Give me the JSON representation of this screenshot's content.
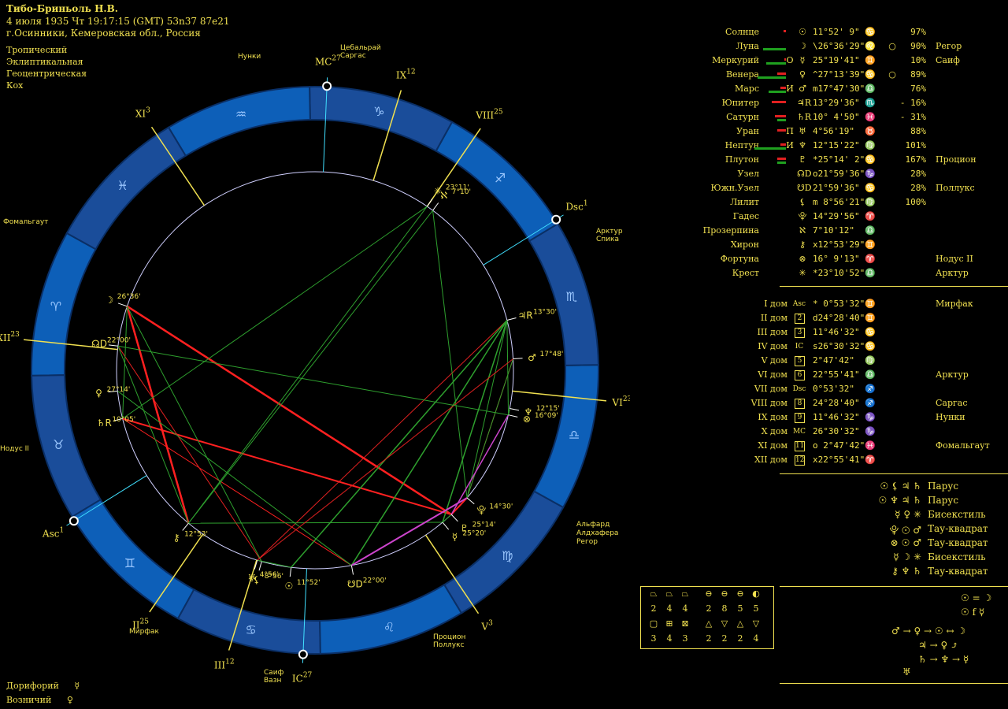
{
  "header": {
    "name": "Тибо-Бриньоль Н.В.",
    "datetime": "4 июля 1935  Чт  19:17:15 (GMT) 53n37  87e21",
    "place": "г.Осинники, Кемеровская обл., Россия"
  },
  "settings": [
    "Тропический",
    "Эклиптикальная",
    "Геоцентрическая",
    "Кох"
  ],
  "footer": [
    {
      "label": "Дорифорий",
      "glyph": "☿"
    },
    {
      "label": "Возничий",
      "glyph": "♀"
    }
  ],
  "planets": [
    {
      "name": "Солнце",
      "bar_green": 0,
      "bar_red": 0.08,
      "letter": "",
      "glyph": "☉",
      "deg": "11°52' 9\"",
      "sign": "♋",
      "ring": "",
      "pct": "97%",
      "star": ""
    },
    {
      "name": "Луна",
      "bar_green": 0.8,
      "bar_red": 0,
      "letter": "",
      "glyph": "☽",
      "deg": "\\26°36'29\"",
      "sign": "♌",
      "ring": "○",
      "pct": "90%",
      "star": "Регор"
    },
    {
      "name": "Меркурий",
      "bar_green": 0.7,
      "bar_red": 0.05,
      "letter": "О",
      "glyph": "☿",
      "deg": "25°19'41\"",
      "sign": "♊",
      "ring": "",
      "pct": "10%",
      "star": "Саиф"
    },
    {
      "name": "Венера",
      "bar_green": 1.0,
      "bar_red": 0.3,
      "letter": "",
      "glyph": "♀",
      "deg": "^27°13'39\"",
      "sign": "♋",
      "ring": "○",
      "pct": "89%",
      "star": ""
    },
    {
      "name": "Марс",
      "bar_green": 0.6,
      "bar_red": 0.2,
      "letter": "И",
      "glyph": "♂",
      "deg": "m17°47'30\"",
      "sign": "♎",
      "ring": "",
      "pct": "76%",
      "star": ""
    },
    {
      "name": "Юпитер",
      "bar_green": 0,
      "bar_red": 0.5,
      "letter": "",
      "glyph": "♃R",
      "deg": "13°29'36\"",
      "sign": "♏",
      "ring": "",
      "pct": "- 16%",
      "star": ""
    },
    {
      "name": "Сатурн",
      "bar_green": 0.3,
      "bar_red": 0.4,
      "letter": "",
      "glyph": "♄R",
      "deg": "10° 4'50\"",
      "sign": "♓",
      "ring": "",
      "pct": "- 31%",
      "star": ""
    },
    {
      "name": "Уран",
      "bar_green": 0,
      "bar_red": 0.3,
      "letter": "П",
      "glyph": "♅",
      "deg": "4°56'19\"",
      "sign": "♉",
      "ring": "",
      "pct": "88%",
      "star": ""
    },
    {
      "name": "Нептун",
      "bar_green": 1.1,
      "bar_red": 0.2,
      "letter": "И",
      "glyph": "♆",
      "deg": "12°15'22\"",
      "sign": "♍",
      "ring": "",
      "pct": "101%",
      "star": ""
    },
    {
      "name": "Плутон",
      "bar_green": 0.3,
      "bar_red": 0.3,
      "letter": "",
      "glyph": "♇",
      "deg": "*25°14' 2\"",
      "sign": "♋",
      "ring": "",
      "pct": "167%",
      "star": "Процион"
    },
    {
      "name": "Узел",
      "bar_green": 0,
      "bar_red": 0,
      "letter": "",
      "glyph": "☊D",
      "deg": "о21°59'36\"",
      "sign": "♑",
      "ring": "",
      "pct": "28%",
      "star": ""
    },
    {
      "name": "Южн.Узел",
      "bar_green": 0,
      "bar_red": 0,
      "letter": "",
      "glyph": "☋D",
      "deg": "21°59'36\"",
      "sign": "♋",
      "ring": "",
      "pct": "28%",
      "star": "Поллукс"
    },
    {
      "name": "Лилит",
      "bar_green": 0,
      "bar_red": 0,
      "letter": "",
      "glyph": "⚸",
      "deg": "m 8°56'21\"",
      "sign": "♍",
      "ring": "",
      "pct": "100%",
      "star": ""
    },
    {
      "name": "Гадес",
      "bar_green": 0,
      "bar_red": 0,
      "letter": "",
      "glyph": "⯓",
      "deg": "14°29'56\"",
      "sign": "♈",
      "ring": "",
      "pct": "",
      "star": ""
    },
    {
      "name": "Прозерпина",
      "bar_green": 0,
      "bar_red": 0,
      "letter": "",
      "glyph": "ℵ",
      "deg": "7°10'12\"",
      "sign": "♎",
      "ring": "",
      "pct": "",
      "star": ""
    },
    {
      "name": "Хирон",
      "bar_green": 0,
      "bar_red": 0,
      "letter": "",
      "glyph": "⚷",
      "deg": "x12°53'29\"",
      "sign": "♊",
      "ring": "",
      "pct": "",
      "star": ""
    },
    {
      "name": "Фортуна",
      "bar_green": 0,
      "bar_red": 0,
      "letter": "",
      "glyph": "⊗",
      "deg": "16° 9'13\"",
      "sign": "♈",
      "ring": "",
      "pct": "",
      "star": "Нодус II"
    },
    {
      "name": "Крест",
      "bar_green": 0,
      "bar_red": 0,
      "letter": "",
      "glyph": "✳",
      "deg": "*23°10'52\"",
      "sign": "♎",
      "ring": "",
      "pct": "",
      "star": "Арктур"
    }
  ],
  "houses": [
    {
      "name": "I дом",
      "glyph": "Asc",
      "deg": "* 0°53'32\"",
      "sign": "♊",
      "star": "Мирфак"
    },
    {
      "name": "II дом",
      "glyph": "2",
      "deg": "d24°28'40\"",
      "sign": "♊",
      "star": ""
    },
    {
      "name": "III дом",
      "glyph": "3",
      "deg": "11°46'32\"",
      "sign": "♋",
      "star": ""
    },
    {
      "name": "IV дом",
      "glyph": "IC",
      "deg": "s26°30'32\"",
      "sign": "♋",
      "star": ""
    },
    {
      "name": "V дом",
      "glyph": "5",
      "deg": "2°47'42\"",
      "sign": "♍",
      "star": ""
    },
    {
      "name": "VI дом",
      "glyph": "6",
      "deg": "22°55'41\"",
      "sign": "♎",
      "star": "Арктур"
    },
    {
      "name": "VII дом",
      "glyph": "Dsc",
      "deg": "0°53'32\"",
      "sign": "♐",
      "star": ""
    },
    {
      "name": "VIII дом",
      "glyph": "8",
      "deg": "24°28'40\"",
      "sign": "♐",
      "star": "Саргас"
    },
    {
      "name": "IX дом",
      "glyph": "9",
      "deg": "11°46'32\"",
      "sign": "♑",
      "star": "Нунки"
    },
    {
      "name": "X дом",
      "glyph": "MC",
      "deg": "26°30'32\"",
      "sign": "♑",
      "star": ""
    },
    {
      "name": "XI дом",
      "glyph": "11",
      "deg": "o 2°47'42\"",
      "sign": "♓",
      "star": "Фомальгаут"
    },
    {
      "name": "XII дом",
      "glyph": "12",
      "deg": "x22°55'41\"",
      "sign": "♈",
      "star": ""
    }
  ],
  "figures": [
    {
      "glyphs": "☉ ⚸ ♃ ♄",
      "label": "Парус"
    },
    {
      "glyphs": "☉ ♆ ♃ ♄",
      "label": "Парус"
    },
    {
      "glyphs": "☿ ♀ ✳",
      "label": "Бисекстиль"
    },
    {
      "glyphs": "⯓ ☉ ♂",
      "label": "Тау-квадрат"
    },
    {
      "glyphs": "⊗ ☉ ♂",
      "label": "Тау-квадрат"
    },
    {
      "glyphs": "☿ ☽ ✳",
      "label": "Бисекстиль"
    },
    {
      "glyphs": "⚷ ♆ ♄",
      "label": "Тау-квадрат"
    }
  ],
  "stats": {
    "row1_glyphs": [
      "⏢",
      "⏢",
      "⏢",
      "⊖",
      "⊖",
      "⊖",
      "◐"
    ],
    "row1": [
      "2",
      "4",
      "4",
      "2",
      "8",
      "5",
      "5"
    ],
    "row2_glyphs": [
      "▢",
      "⊞",
      "⊠",
      "△",
      "▽",
      "△",
      "▽"
    ],
    "row2": [
      "3",
      "4",
      "3",
      "2",
      "2",
      "2",
      "4"
    ]
  },
  "dispositor": {
    "line1": "☉ = ☽",
    "line2": "☉ f ☿",
    "line3": "♂ → ♀ → ☉ ↔ ☽",
    "line4": "♃ → ♀ ⤴",
    "line5": "♄ → ♆ → ☿",
    "line6": "♅"
  },
  "wheel": {
    "house_labels": [
      {
        "t": "Asc",
        "n": "1"
      },
      {
        "t": "II",
        "n": "25"
      },
      {
        "t": "III",
        "n": "12"
      },
      {
        "t": "IC",
        "n": "27"
      },
      {
        "t": "V",
        "n": "3"
      },
      {
        "t": "VI",
        "n": "23"
      },
      {
        "t": "Dsc",
        "n": "1"
      },
      {
        "t": "VIII",
        "n": "25"
      },
      {
        "t": "IX",
        "n": "12"
      },
      {
        "t": "MC",
        "n": "27"
      },
      {
        "t": "XI",
        "n": "3"
      },
      {
        "t": "XII",
        "n": "23"
      }
    ],
    "stars": [
      "Нунки",
      "Цебальрай",
      "Саргас",
      "Арктур",
      "Спика",
      "Фомальгаут",
      "Альфард",
      "Алдхафера",
      "Регор",
      "Процион",
      "Поллукс",
      "Мирфак",
      "Саиф",
      "Вазн",
      "Нодус II"
    ],
    "planet_labels": [
      {
        "g": "♃R",
        "d": "13°30'"
      },
      {
        "g": "✳",
        "d": "23°11'"
      },
      {
        "g": "♂",
        "d": "17°48'"
      },
      {
        "g": "ℵ",
        "d": "7°10'"
      },
      {
        "g": "♆",
        "d": "12°15'"
      },
      {
        "g": "⚸",
        "d": "8°56'"
      },
      {
        "g": "☽",
        "d": "26°36'"
      },
      {
        "g": "♀",
        "d": "27°14'"
      },
      {
        "g": "♇",
        "d": "25°14'"
      },
      {
        "g": "☋D",
        "d": "22°00'"
      },
      {
        "g": "☉",
        "d": "11°52'"
      },
      {
        "g": "☿",
        "d": "25°20'"
      },
      {
        "g": "⚷",
        "d": "12°53'"
      },
      {
        "g": "♅",
        "d": "4°56'"
      },
      {
        "g": "⯓",
        "d": "14°30'"
      },
      {
        "g": "⊗",
        "d": "16°09'"
      },
      {
        "g": "♄R",
        "d": "10°05'"
      },
      {
        "g": "☊D",
        "d": "22°00'"
      }
    ],
    "signs": [
      "♈",
      "♉",
      "♊",
      "♋",
      "♌",
      "♍",
      "♎",
      "♏",
      "♐",
      "♑",
      "♒",
      "♓"
    ]
  }
}
